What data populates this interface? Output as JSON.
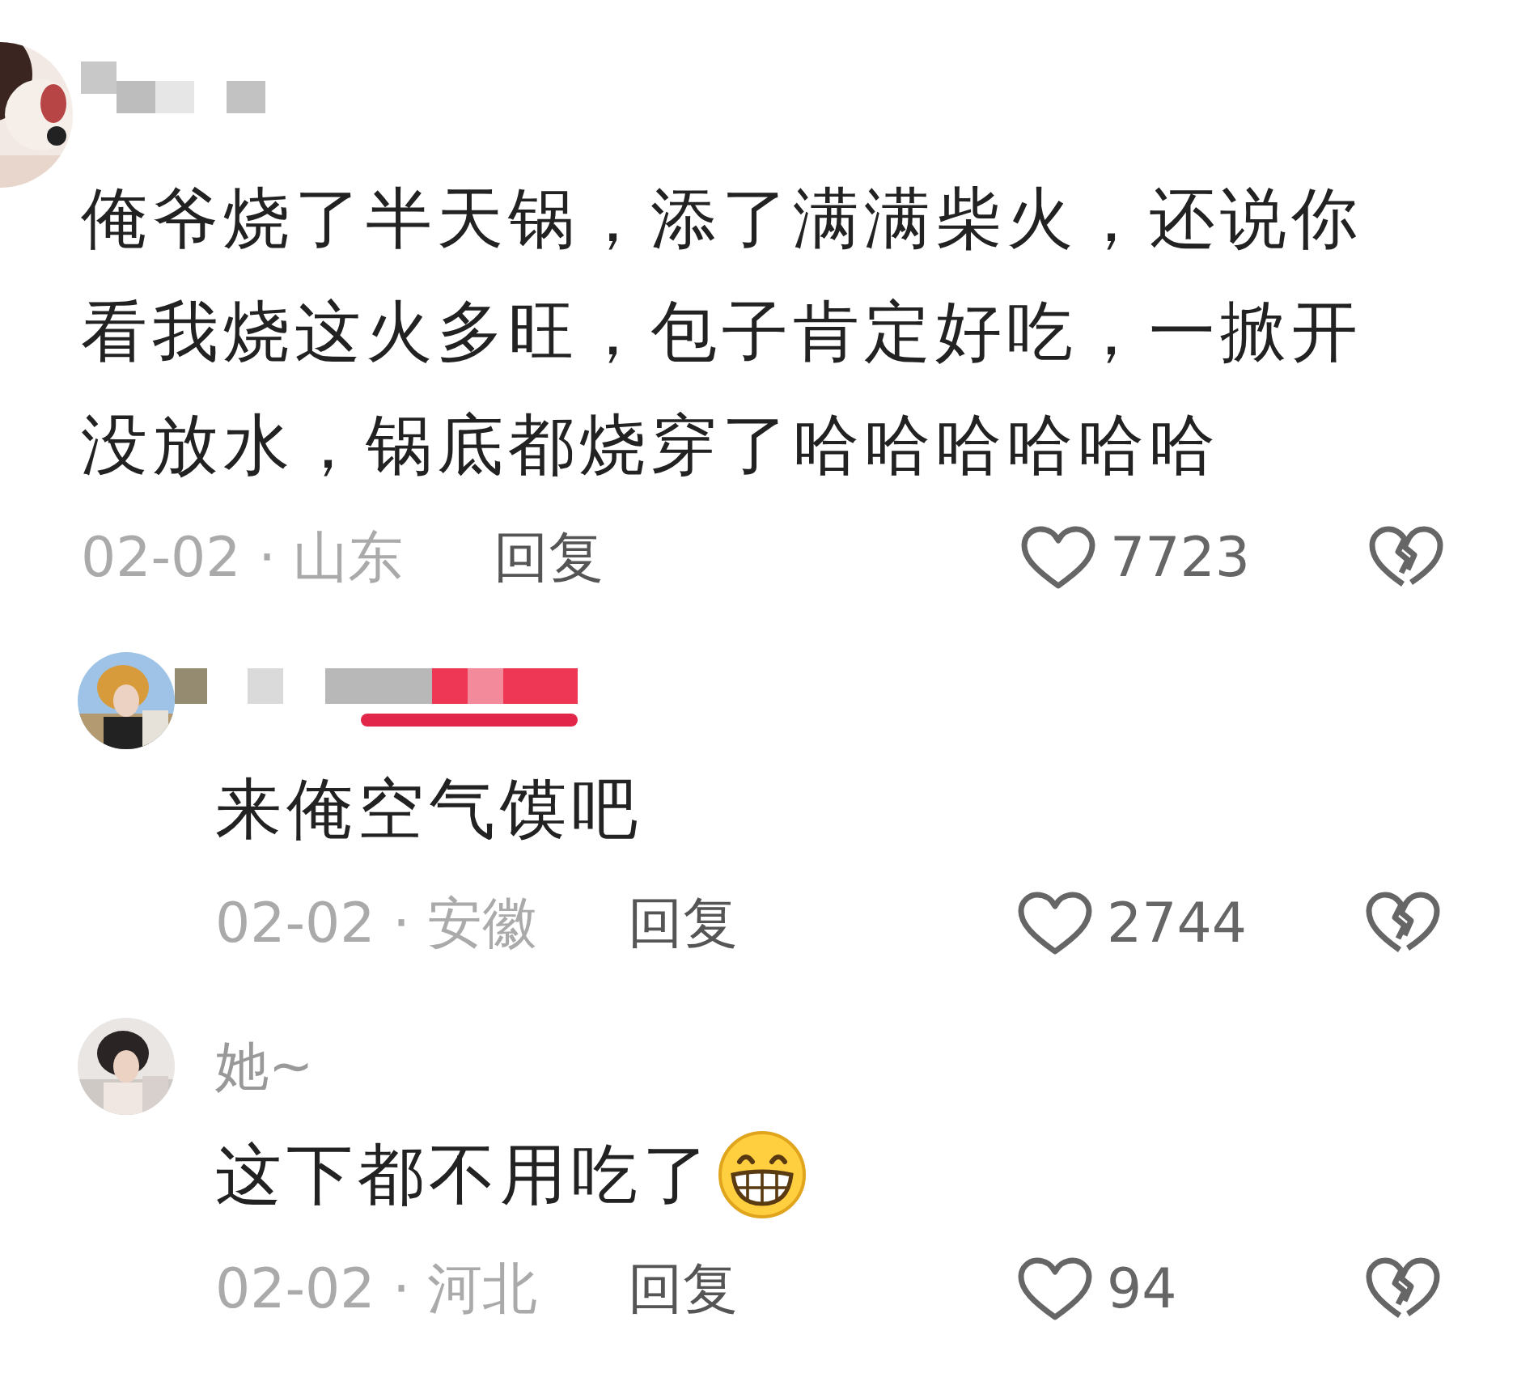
{
  "comments": [
    {
      "name_pixelated": true,
      "text": "俺爷烧了半天锅，添了满满柴火，还说你看我烧这火多旺，包子肯定好吃，一掀开没放水，锅底都烧穿了哈哈哈哈哈哈",
      "date": "02-02 · 山东",
      "reply_label": "回复",
      "likes": "7723",
      "replies": [
        {
          "name_pixelated": true,
          "badge_pixelated": true,
          "text": "来俺空气馍吧",
          "date": "02-02 · 安徽",
          "reply_label": "回复",
          "likes": "2744"
        },
        {
          "name": "她~",
          "text": "这下都不用吃了",
          "emoji": true,
          "date": "02-02 · 河北",
          "reply_label": "回复",
          "likes": "94"
        }
      ]
    }
  ]
}
